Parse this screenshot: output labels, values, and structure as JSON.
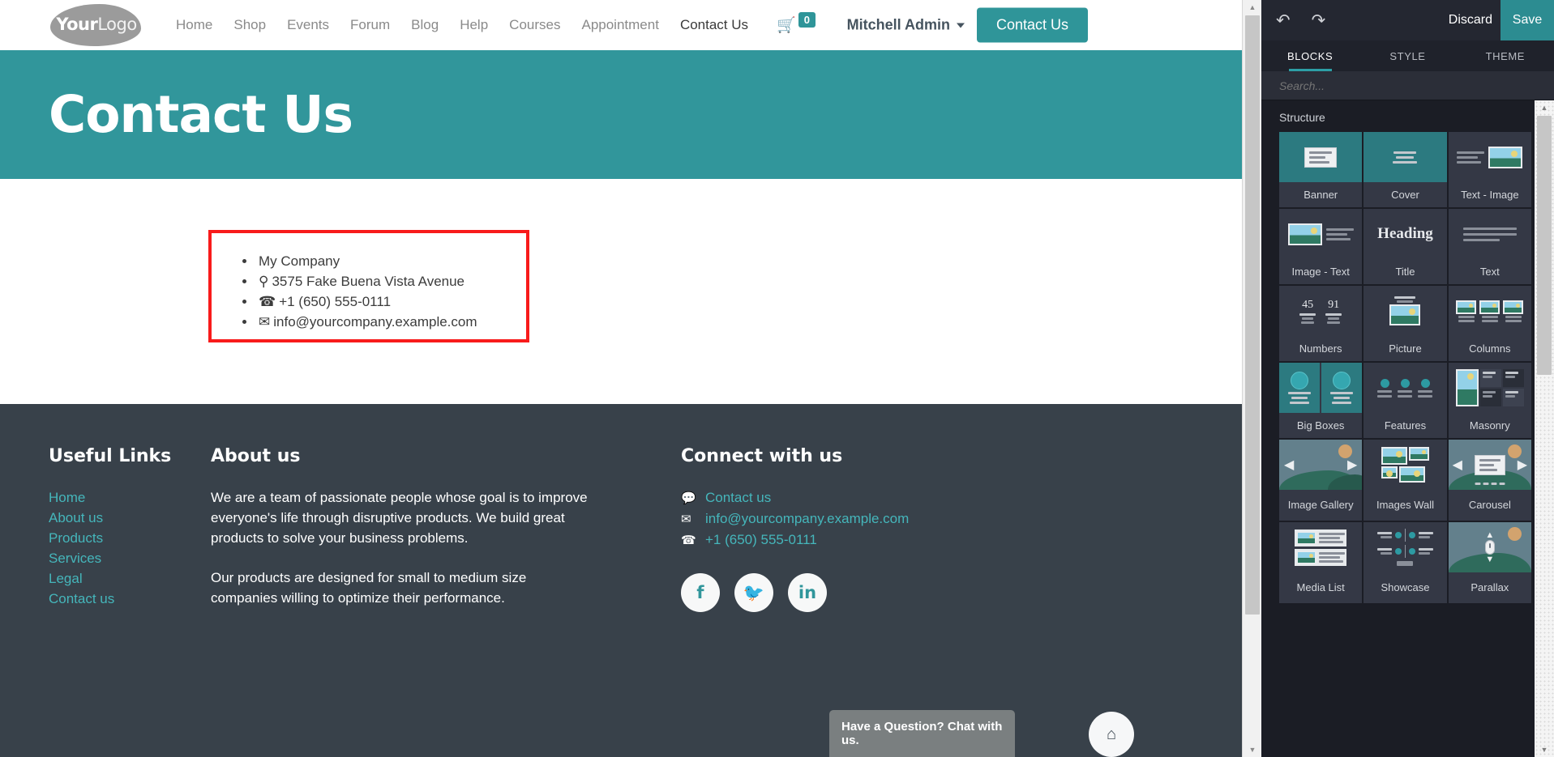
{
  "website": {
    "navbar": {
      "logo": {
        "bold": "Your",
        "light": "Logo"
      },
      "menu": [
        {
          "label": "Home",
          "active": false
        },
        {
          "label": "Shop",
          "active": false
        },
        {
          "label": "Events",
          "active": false
        },
        {
          "label": "Forum",
          "active": false
        },
        {
          "label": "Blog",
          "active": false
        },
        {
          "label": "Help",
          "active": false
        },
        {
          "label": "Courses",
          "active": false
        },
        {
          "label": "Appointment",
          "active": false
        },
        {
          "label": "Contact Us",
          "active": true
        }
      ],
      "cart": {
        "icon": "shopping-cart-icon",
        "count": "0"
      },
      "user": {
        "name": "Mitchell Admin"
      },
      "cta": {
        "label": "Contact Us"
      }
    },
    "hero": {
      "title": "Contact Us"
    },
    "contact_card": {
      "items": [
        {
          "icon": "",
          "text": "My Company"
        },
        {
          "icon": "⚑",
          "icon_name": "map-marker-icon",
          "text": "3575 Fake Buena Vista Avenue"
        },
        {
          "icon": "✆",
          "icon_name": "phone-icon",
          "text": "+1 (650) 555-0111"
        },
        {
          "icon": "✉",
          "icon_name": "envelope-icon",
          "text": "info@yourcompany.example.com"
        }
      ],
      "highlight_color": "#f81b1b"
    },
    "footer": {
      "links_column": {
        "title": "Useful Links",
        "links": [
          "Home",
          "About us",
          "Products",
          "Services",
          "Legal",
          "Contact us"
        ]
      },
      "about_column": {
        "title": "About us",
        "paragraphs": [
          "We are a team of passionate people whose goal is to improve everyone's life through disruptive products. We build great products to solve your business problems.",
          "Our products are designed for small to medium size companies willing to optimize their performance."
        ]
      },
      "connect_column": {
        "title": "Connect with us",
        "rows": [
          {
            "icon": "὞9",
            "icon_name": "comment-icon",
            "text": "Contact us"
          },
          {
            "icon": "✉",
            "icon_name": "envelope-icon",
            "text": "info@yourcompany.example.com"
          },
          {
            "icon": "✆",
            "icon_name": "phone-icon",
            "text": "+1 (650) 555-0111"
          }
        ],
        "socials": [
          {
            "name": "facebook-icon",
            "glyph": "f"
          },
          {
            "name": "twitter-icon",
            "glyph": "ᵗ"
          },
          {
            "name": "linkedin-icon",
            "glyph": "in"
          }
        ]
      },
      "scroll_top": {
        "icon": "home-icon",
        "glyph": "⌂"
      }
    },
    "chat_widget": {
      "label": "Have a Question? Chat with us."
    }
  },
  "editor": {
    "toolbar": {
      "undo": "↶",
      "redo": "↷",
      "discard_label": "Discard",
      "save_label": "Save",
      "save_color": "#2c8c91"
    },
    "tabs": [
      {
        "label": "BLOCKS",
        "active": true
      },
      {
        "label": "STYLE",
        "active": false
      },
      {
        "label": "THEME",
        "active": false
      }
    ],
    "search": {
      "placeholder": "Search...",
      "value": ""
    },
    "sections": [
      {
        "title": "Structure",
        "blocks": [
          {
            "label": "Banner",
            "thumb": "banner",
            "selected": false
          },
          {
            "label": "Cover",
            "thumb": "cover",
            "selected": false
          },
          {
            "label": "Text - Image",
            "thumb": "text-image",
            "selected": false
          },
          {
            "label": "Image - Text",
            "thumb": "image-text",
            "selected": false
          },
          {
            "label": "Title",
            "thumb": "title",
            "selected": false
          },
          {
            "label": "Text",
            "thumb": "text",
            "selected": true
          },
          {
            "label": "Numbers",
            "thumb": "numbers",
            "selected": false
          },
          {
            "label": "Picture",
            "thumb": "picture",
            "selected": false
          },
          {
            "label": "Columns",
            "thumb": "columns",
            "selected": false
          },
          {
            "label": "Big Boxes",
            "thumb": "bigboxes",
            "selected": false
          },
          {
            "label": "Features",
            "thumb": "features",
            "selected": false
          },
          {
            "label": "Masonry",
            "thumb": "masonry",
            "selected": false
          },
          {
            "label": "Image Gallery",
            "thumb": "gallery",
            "selected": false
          },
          {
            "label": "Images Wall",
            "thumb": "imageswall",
            "selected": false
          },
          {
            "label": "Carousel",
            "thumb": "carousel",
            "selected": false
          },
          {
            "label": "Media List",
            "thumb": "medialist",
            "selected": false
          },
          {
            "label": "Showcase",
            "thumb": "showcase",
            "selected": false
          },
          {
            "label": "Parallax",
            "thumb": "parallax",
            "selected": false
          }
        ]
      }
    ],
    "numbers_thumb": {
      "a": "45",
      "b": "91"
    },
    "title_thumb": {
      "text": "Heading"
    }
  }
}
